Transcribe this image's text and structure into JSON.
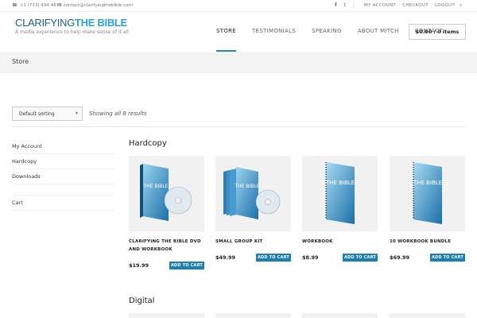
{
  "topbar": {
    "phone": "+1 (713) 494-4878",
    "email": "contact@clarifyingthebible.com",
    "links": [
      "MY ACCOUNT",
      "CHECKOUT",
      "LOGOUT"
    ]
  },
  "logo": {
    "part_a": "CLARIFYING",
    "part_b": "THE BIBLE",
    "tagline": "A media experience to help make sense of it all"
  },
  "nav": {
    "items": [
      "STORE",
      "TESTIMONIALS",
      "SPEAKING",
      "ABOUT MITCH",
      "CONTACT"
    ],
    "active_index": 0
  },
  "cart": {
    "label": "$0.00 / 0 items"
  },
  "page": {
    "title": "Store"
  },
  "toolbar": {
    "sort_value": "Default sorting",
    "result_count": "Showing all 8 results"
  },
  "sidebar": {
    "items": [
      "My Account",
      "Hardcopy",
      "Downloads",
      "Cart"
    ]
  },
  "sections": {
    "hardcopy": {
      "title": "Hardcopy",
      "products": [
        {
          "name": "CLARIFYING THE BIBLE DVD AND WORKBOOK",
          "price": "$19.99",
          "button": "ADD TO CART"
        },
        {
          "name": "SMALL GROUP KIT",
          "price": "$49.99",
          "button": "ADD TO CART"
        },
        {
          "name": "WORKBOOK",
          "price": "$8.99",
          "button": "ADD TO CART"
        },
        {
          "name": "10 WORKBOOK BUNDLE",
          "price": "$69.99",
          "button": "ADD TO CART"
        }
      ]
    },
    "digital": {
      "title": "Digital"
    }
  },
  "cover_text": "THE BIBLE",
  "colors": {
    "accent": "#1b7fb3",
    "logo_dark": "#1b5e8c",
    "logo_light": "#2aa2d6",
    "band": "#f3f3f3"
  },
  "icons": [
    "phone-icon",
    "mail-icon",
    "facebook-icon",
    "twitter-icon",
    "search-icon",
    "dropdown-arrow-icon"
  ]
}
